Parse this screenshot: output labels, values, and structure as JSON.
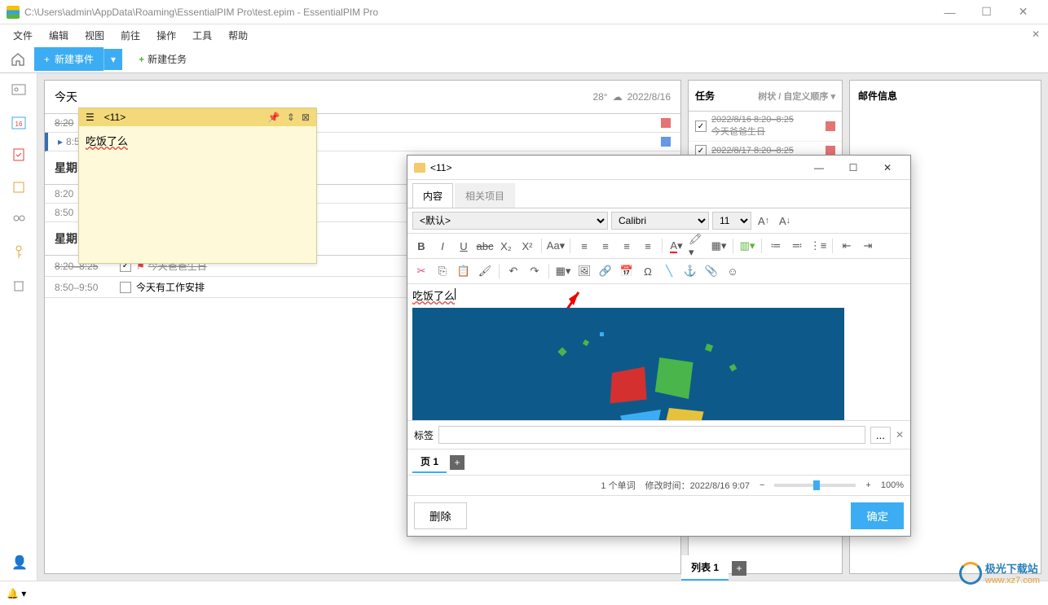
{
  "titlebar": {
    "path": "C:\\Users\\admin\\AppData\\Roaming\\EssentialPIM Pro\\test.epim - EssentialPIM Pro"
  },
  "menubar": {
    "items": [
      "文件",
      "编辑",
      "视图",
      "前往",
      "操作",
      "工具",
      "帮助"
    ]
  },
  "toolbar": {
    "new_event": "新建事件",
    "new_task": "新建任务"
  },
  "calendar": {
    "today_label": "今天",
    "temp": "28°",
    "date": "2022/8/16",
    "rows": [
      {
        "time": "8:20",
        "marker": false,
        "color": "red"
      },
      {
        "time": "8:50",
        "marker": true,
        "color": "blue"
      }
    ],
    "section2": "星期",
    "section2_rows": [
      {
        "time": "8:20"
      },
      {
        "time": "8:50"
      }
    ],
    "section3": "星期",
    "section3_rows": [
      {
        "time": "8:20–8:25",
        "checked": true,
        "flag": true,
        "text": "今天爸爸生日",
        "strike": true
      },
      {
        "time": "8:50–9:50",
        "checked": false,
        "flag": false,
        "text": "今天有工作安排",
        "strike": false
      }
    ]
  },
  "tasks": {
    "header": "任务",
    "sort": "树状 / 自定义顺序",
    "items": [
      {
        "text": "2022/8/16 8:20–8:25",
        "sub": "今天爸爸生日",
        "color": "red"
      },
      {
        "text": "2022/8/17 8:20–8:25",
        "color": "red"
      }
    ]
  },
  "mail": {
    "header": "邮件信息"
  },
  "sticky": {
    "title": "<11>",
    "body": "吃饭了么"
  },
  "editor": {
    "title": "<11>",
    "tabs": {
      "content": "内容",
      "related": "相关项目"
    },
    "style_select": "<默认>",
    "font": "Calibri",
    "size": "11",
    "text": "吃饭了么",
    "tags_label": "标签",
    "tags_more": "...",
    "page_label": "页 1",
    "word_count": "1 个单词",
    "modified_label": "修改时间：",
    "modified_time": "2022/8/16 9:07",
    "zoom": "100%",
    "delete": "删除",
    "ok": "确定"
  },
  "bottom_tab": "列表 1",
  "watermark": {
    "line1": "极光下载站",
    "line2": "www.xz7.com"
  }
}
